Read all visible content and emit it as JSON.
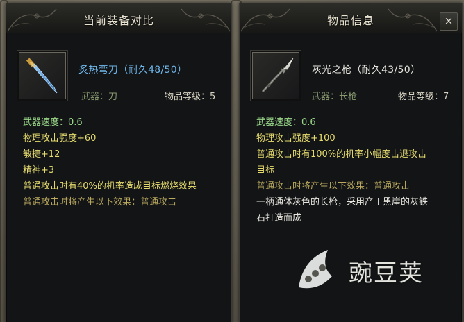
{
  "left_panel": {
    "title": "当前装备对比",
    "item": {
      "name": "炙热弯刀（耐久48/50）",
      "name_color": "#6fb6ea",
      "type_text": "武器：刀",
      "level_text": "物品等级：5",
      "icon": "curved-blade-icon"
    },
    "stats": [
      {
        "text": "武器速度：0.6",
        "color": "green"
      },
      {
        "text": "物理攻击强度+60",
        "color": "yellow"
      },
      {
        "text": "敏捷+12",
        "color": "yellow"
      },
      {
        "text": "精神+3",
        "color": "yellow"
      },
      {
        "text": "普通攻击时有40%的机率造成目标燃烧效果",
        "color": "yellow"
      },
      {
        "text": "普通攻击时将产生以下效果：普通攻击",
        "color": "olive"
      }
    ]
  },
  "right_panel": {
    "title": "物品信息",
    "close_label": "×",
    "item": {
      "name": "灰光之枪（耐久43/50）",
      "name_color": "#e8e6df",
      "type_text": "武器：长枪",
      "level_text": "物品等级：7",
      "icon": "spear-icon"
    },
    "stats": [
      {
        "text": "武器速度：0.6",
        "color": "green"
      },
      {
        "text": "物理攻击强度+100",
        "color": "yellow"
      },
      {
        "text": "普通攻击时有100%的机率小幅度击退攻击",
        "color": "yellow"
      },
      {
        "text": "目标",
        "color": "yellow"
      },
      {
        "text": "普通攻击时将产生以下效果：普通攻击",
        "color": "olive"
      },
      {
        "text": "一柄通体灰色的长枪，采用产于黑崖的灰铁",
        "color": "white"
      },
      {
        "text": "石打造而成",
        "color": "white"
      }
    ]
  },
  "watermark": {
    "text": "豌豆荚",
    "icon": "pea-pod-logo-icon"
  }
}
